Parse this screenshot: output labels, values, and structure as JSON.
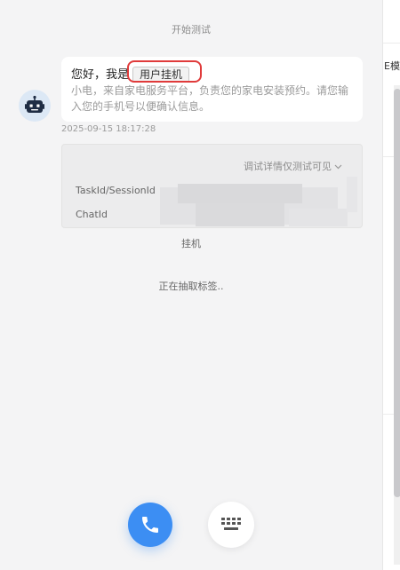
{
  "header": {
    "start_label": "开始测试"
  },
  "message": {
    "greeting": "您好，我是",
    "tag_label": "用户挂机",
    "body": "小电，来自家电服务平台，负责您的家电安装预约。请您输入您的手机号以便确认信息。",
    "timestamp": "2025-09-15 18:17:28"
  },
  "debug": {
    "toggle_label": "调试详情仅测试可见",
    "task_label": "TaskId/SessionId",
    "chat_label": "ChatId"
  },
  "status": {
    "hangup": "挂机",
    "extracting": "正在抽取标签.."
  },
  "side": {
    "snippet": "E模板"
  },
  "colors": {
    "accent": "#3c8ef3",
    "highlight": "#e03b3b"
  },
  "icons": {
    "avatar": "robot-icon",
    "call": "phone-icon",
    "keyboard": "keyboard-icon",
    "toggle": "chevron-down-icon"
  }
}
